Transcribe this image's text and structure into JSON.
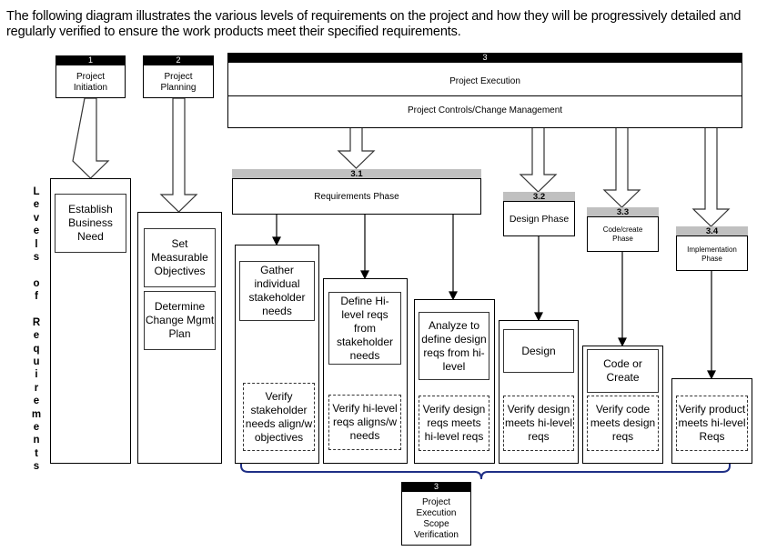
{
  "intro_text": "The following diagram illustrates the various levels of requirements on the project and how they will be progressively detailed and regularly verified to ensure the work products meet their specified requirements.",
  "side_label": "Levels of Requirements",
  "side_label_letters": [
    "L",
    "e",
    "v",
    "e",
    "l",
    "s",
    "",
    "o",
    "f",
    "",
    "R",
    "e",
    "q",
    "u",
    "i",
    "r",
    "e",
    "m",
    "e",
    "n",
    "t",
    "s"
  ],
  "phases": {
    "p1": {
      "number": "1",
      "title": "Project Initiation"
    },
    "p2": {
      "number": "2",
      "title": "Project Planning"
    },
    "p3": {
      "number": "3",
      "title": "Project Execution",
      "subtitle": "Project Controls/Change Management"
    },
    "p31": {
      "number": "3.1",
      "title": "Requirements Phase"
    },
    "p32": {
      "number": "3.2",
      "title": "Design Phase"
    },
    "p33": {
      "number": "3.3",
      "title": "Code/create Phase"
    },
    "p34": {
      "number": "3.4",
      "title": "Implementation Phase"
    }
  },
  "activities": {
    "establish": "Establish Business Need",
    "set_objectives": "Set Measurable Objectives",
    "change_plan": "Determine Change Mgmt Plan",
    "gather": "Gather individual stakeholder needs",
    "define_hilevel": "Define Hi-level reqs from stakeholder needs",
    "analyze": "Analyze to define design reqs from hi-level",
    "design": "Design",
    "code": "Code or Create"
  },
  "verifications": {
    "v1": "Verify stakeholder needs align/w objectives",
    "v2": "Verify hi-level reqs aligns/w needs",
    "v3": "Verify design reqs meets hi-level reqs",
    "v4": "Verify design meets hi-level reqs",
    "v5": "Verify code meets design reqs",
    "v6": "Verify product meets hi-level Reqs"
  },
  "scope_verification": {
    "number": "3",
    "title": "Project Execution Scope Verification"
  },
  "colors": {
    "brace": "#1f2f86",
    "gray_header": "#c0c0c0"
  }
}
